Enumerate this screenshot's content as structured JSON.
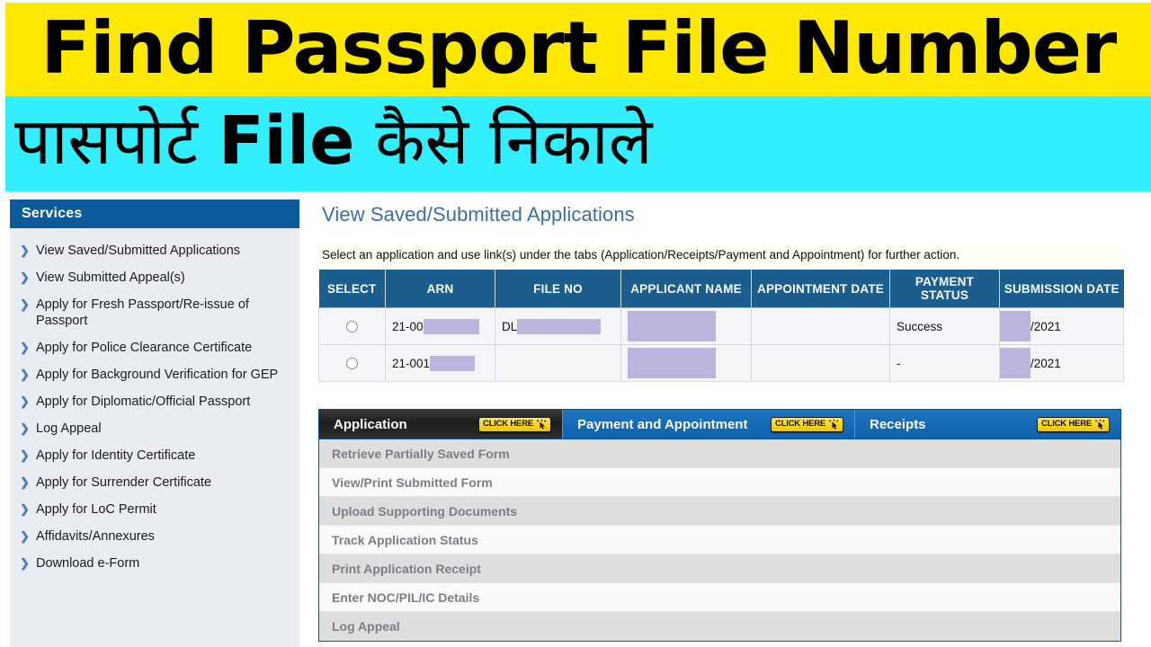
{
  "banner": {
    "line1": "Find Passport File Number",
    "line2_pre": "पासपोर्ट ",
    "line2_bold": "File",
    "line2_post": " कैसे निकाले",
    "yellow_color": "#FFE800",
    "cyan_color": "#33EEFF"
  },
  "sidebar": {
    "header": "Services",
    "items": [
      {
        "label": "View Saved/Submitted Applications",
        "icon": "chevron-right-icon"
      },
      {
        "label": "View Submitted Appeal(s)",
        "icon": "chevron-right-icon"
      },
      {
        "label": "Apply for Fresh Passport/Re-issue of Passport",
        "icon": "chevron-right-icon"
      },
      {
        "label": "Apply for Police Clearance Certificate",
        "icon": "chevron-right-icon"
      },
      {
        "label": "Apply for Background Verification for GEP",
        "icon": "chevron-right-icon"
      },
      {
        "label": "Apply for Diplomatic/Official Passport",
        "icon": "chevron-right-icon"
      },
      {
        "label": "Log Appeal",
        "icon": "chevron-right-icon"
      },
      {
        "label": "Apply for Identity Certificate",
        "icon": "chevron-right-icon"
      },
      {
        "label": "Apply for Surrender Certificate",
        "icon": "chevron-right-icon"
      },
      {
        "label": "Apply for LoC Permit",
        "icon": "chevron-right-icon"
      },
      {
        "label": "Affidavits/Annexures",
        "icon": "chevron-right-icon"
      },
      {
        "label": "Download e-Form",
        "icon": "chevron-right-icon"
      }
    ]
  },
  "main": {
    "title": "View Saved/Submitted Applications",
    "instruction": "Select an application and use link(s) under the tabs (Application/Receipts/Payment and Appointment) for further action.",
    "table": {
      "headers": [
        "SELECT",
        "ARN",
        "FILE NO",
        "APPLICANT NAME",
        "APPOINTMENT DATE",
        "PAYMENT STATUS",
        "SUBMISSION DATE"
      ],
      "rows": [
        {
          "select": "",
          "arn_prefix": "21-00",
          "arn_redacted": true,
          "fileno_prefix": "DL",
          "fileno_redacted": true,
          "applicant_name": "",
          "applicant_redacted": true,
          "appointment_date": "",
          "payment_status": "Success",
          "submission_date_redacted": true,
          "submission_date_suffix": "/2021"
        },
        {
          "select": "",
          "arn_prefix": "21-001",
          "arn_redacted": true,
          "fileno_prefix": "",
          "fileno_redacted": false,
          "applicant_name": "",
          "applicant_redacted": true,
          "appointment_date": "",
          "payment_status": "-",
          "submission_date_redacted": true,
          "submission_date_suffix": "/2021"
        }
      ]
    },
    "tabs": [
      {
        "label": "Application",
        "active": true,
        "badge": "CLICK HERE",
        "badge_icon": "click-cursor-icon"
      },
      {
        "label": "Payment and Appointment",
        "active": false,
        "badge": "CLICK HERE",
        "badge_icon": "click-cursor-icon"
      },
      {
        "label": "Receipts",
        "active": false,
        "badge": "CLICK HERE",
        "badge_icon": "click-cursor-icon"
      }
    ],
    "panel_links": [
      "Retrieve Partially Saved Form",
      "View/Print Submitted Form",
      "Upload Supporting Documents",
      "Track Application Status",
      "Print Application Receipt",
      "Enter NOC/PIL/IC Details",
      "Log Appeal"
    ]
  },
  "colors": {
    "header_blue": "#1B5E8E",
    "sidebar_blue": "#0B5A9B",
    "tab_blue": "#0F62AD",
    "redaction": "#BDB4DE",
    "title_blue": "#3B6EA5"
  }
}
